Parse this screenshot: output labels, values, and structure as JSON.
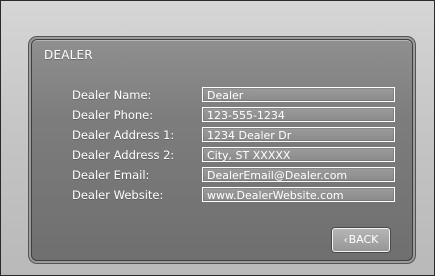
{
  "panel": {
    "title": "DEALER"
  },
  "fields": [
    {
      "label": "Dealer Name:",
      "value": "Dealer"
    },
    {
      "label": "Dealer Phone:",
      "value": "123-555-1234"
    },
    {
      "label": "Dealer Address 1:",
      "value": "1234 Dealer Dr"
    },
    {
      "label": "Dealer Address 2:",
      "value": "City, ST XXXXX"
    },
    {
      "label": "Dealer Email:",
      "value": "DealerEmail@Dealer.com"
    },
    {
      "label": "Dealer Website:",
      "value": "www.DealerWebsite.com"
    }
  ],
  "buttons": {
    "back_chevron": "‹",
    "back_label": "BACK"
  }
}
